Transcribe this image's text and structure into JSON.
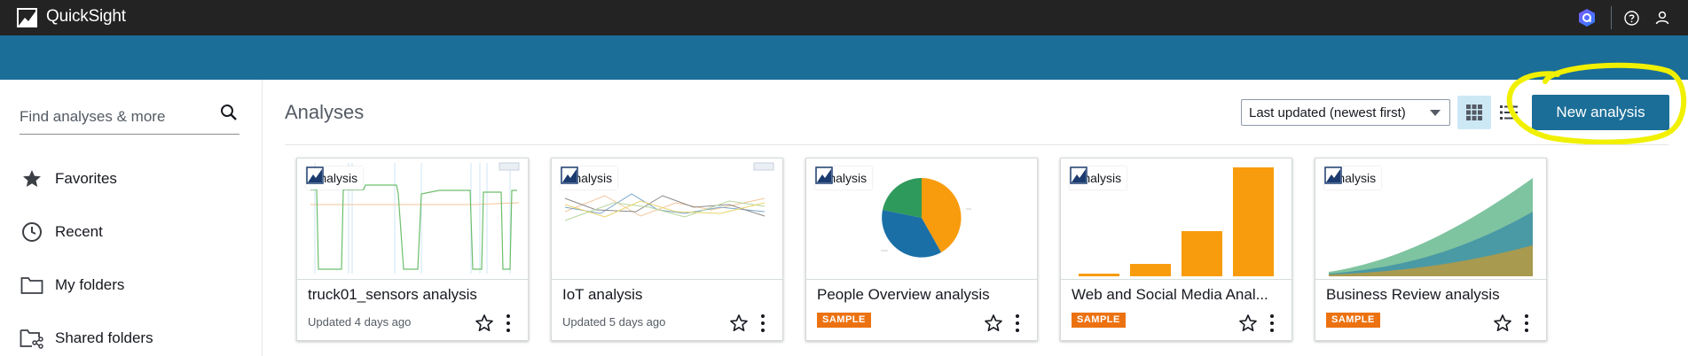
{
  "topbar": {
    "app_title": "QuickSight",
    "icons": [
      "quicksight-logo-icon",
      "amazon-q-icon",
      "help-icon",
      "user-icon"
    ]
  },
  "sidebar": {
    "search_placeholder": "Find analyses & more",
    "items": [
      {
        "label": "Favorites",
        "icon": "star-icon"
      },
      {
        "label": "Recent",
        "icon": "clock-icon"
      },
      {
        "label": "My folders",
        "icon": "folder-icon"
      },
      {
        "label": "Shared folders",
        "icon": "shared-folder-icon"
      }
    ]
  },
  "main": {
    "title": "Analyses",
    "sort": {
      "selected": "Last updated (newest first)"
    },
    "view_modes": [
      "grid-view-icon",
      "list-view-icon"
    ],
    "new_button_label": "New analysis",
    "colors": {
      "accent": "#1b6e98",
      "sample": "#ec7211",
      "highlight": "#f5f500"
    },
    "cards": [
      {
        "badge": "Analysis",
        "title": "truck01_sensors analysis",
        "meta": "Updated 4 days ago",
        "sample": false,
        "thumb": "line-steps"
      },
      {
        "badge": "Analysis",
        "title": "IoT analysis",
        "meta": "Updated 5 days ago",
        "sample": false,
        "thumb": "multi-line"
      },
      {
        "badge": "Analysis",
        "title": "People Overview analysis",
        "meta": "SAMPLE",
        "sample": true,
        "thumb": "pie"
      },
      {
        "badge": "Analysis",
        "title": "Web and Social Media Anal...",
        "meta": "SAMPLE",
        "sample": true,
        "thumb": "bar"
      },
      {
        "badge": "Analysis",
        "title": "Business Review analysis",
        "meta": "SAMPLE",
        "sample": true,
        "thumb": "area"
      }
    ]
  }
}
